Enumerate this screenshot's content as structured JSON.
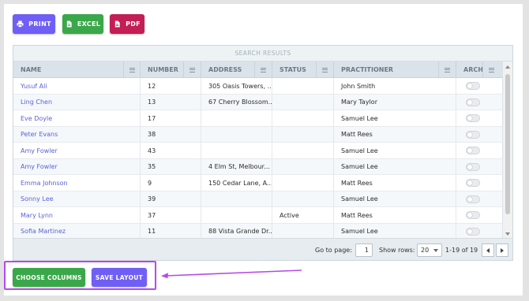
{
  "toolbar": {
    "print_label": "PRINT",
    "excel_label": "EXCEL",
    "pdf_label": "PDF"
  },
  "grid": {
    "title": "SEARCH RESULTS",
    "columns": [
      "NAME",
      "NUMBER",
      "ADDRESS",
      "STATUS",
      "PRACTITIONER",
      "ARCH"
    ],
    "rows": [
      {
        "name": "Yusuf Ali",
        "number": "12",
        "address": "305 Oasis Towers, ...",
        "status": "",
        "practitioner": "John Smith",
        "archived": false
      },
      {
        "name": "Ling Chen",
        "number": "13",
        "address": "67 Cherry Blossom...",
        "status": "",
        "practitioner": "Mary Taylor",
        "archived": false
      },
      {
        "name": "Eve Doyle",
        "number": "17",
        "address": "",
        "status": "",
        "practitioner": "Samuel Lee",
        "archived": false
      },
      {
        "name": "Peter Evans",
        "number": "38",
        "address": "",
        "status": "",
        "practitioner": "Matt Rees",
        "archived": false
      },
      {
        "name": "Amy Fowler",
        "number": "43",
        "address": "",
        "status": "",
        "practitioner": "Samuel Lee",
        "archived": false
      },
      {
        "name": "Amy Fowler",
        "number": "35",
        "address": "4 Elm St, Melbour...",
        "status": "",
        "practitioner": "Samuel Lee",
        "archived": false
      },
      {
        "name": "Emma Johnson",
        "number": "9",
        "address": "150 Cedar Lane, A...",
        "status": "",
        "practitioner": "Matt Rees",
        "archived": false
      },
      {
        "name": "Sonny Lee",
        "number": "39",
        "address": "",
        "status": "",
        "practitioner": "Samuel Lee",
        "archived": false
      },
      {
        "name": "Mary Lynn",
        "number": "37",
        "address": "",
        "status": "Active",
        "practitioner": "Matt Rees",
        "archived": false
      },
      {
        "name": "Sofia Martinez",
        "number": "11",
        "address": "88 Vista Grande Dr...",
        "status": "",
        "practitioner": "Samuel Lee",
        "archived": false
      }
    ]
  },
  "footer": {
    "goto_label": "Go to page:",
    "goto_value": "1",
    "show_rows_label": "Show rows:",
    "show_rows_value": "20",
    "range_text": "1-19 of 19"
  },
  "actions": {
    "choose_columns_label": "CHOOSE COLUMNS",
    "save_layout_label": "SAVE LAYOUT"
  },
  "colors": {
    "primary": "#6f5ff5",
    "success": "#3aa84a",
    "danger": "#c31e55",
    "highlight": "#b44ce6",
    "link": "#5b62d6"
  },
  "icons": {
    "print": "printer-icon",
    "excel": "file-excel-icon",
    "pdf": "file-pdf-icon",
    "column_menu": "column-menu-icon"
  }
}
